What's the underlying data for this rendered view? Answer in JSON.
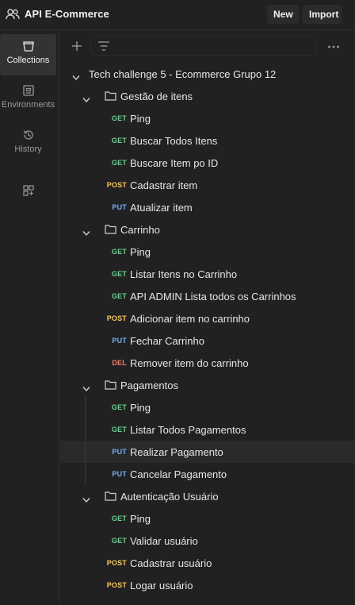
{
  "header": {
    "workspace_title": "API E-Commerce",
    "new_label": "New",
    "import_label": "Import"
  },
  "sidebar": {
    "items": [
      {
        "label": "Collections",
        "icon": "collections-icon",
        "active": true
      },
      {
        "label": "Environments",
        "icon": "environments-icon",
        "active": false
      },
      {
        "label": "History",
        "icon": "history-icon",
        "active": false
      },
      {
        "label": "",
        "icon": "add-apps-icon",
        "active": false
      }
    ]
  },
  "collection": {
    "name": "Tech challenge 5 - Ecommerce Grupo 12",
    "folders": [
      {
        "name": "Gestão de itens",
        "requests": [
          {
            "method": "GET",
            "name": "Ping"
          },
          {
            "method": "GET",
            "name": "Buscar Todos Itens"
          },
          {
            "method": "GET",
            "name": "Buscare Item po ID"
          },
          {
            "method": "POST",
            "name": "Cadastrar item"
          },
          {
            "method": "PUT",
            "name": "Atualizar item"
          }
        ]
      },
      {
        "name": "Carrinho",
        "requests": [
          {
            "method": "GET",
            "name": "Ping"
          },
          {
            "method": "GET",
            "name": "Listar Itens no Carrinho"
          },
          {
            "method": "GET",
            "name": "API ADMIN Lista todos os Carrinhos"
          },
          {
            "method": "POST",
            "name": "Adicionar item no carrinho"
          },
          {
            "method": "PUT",
            "name": "Fechar Carrinho"
          },
          {
            "method": "DEL",
            "name": "Remover item do carrinho"
          }
        ]
      },
      {
        "name": "Pagamentos",
        "requests": [
          {
            "method": "GET",
            "name": "Ping"
          },
          {
            "method": "GET",
            "name": "Listar Todos Pagamentos"
          },
          {
            "method": "PUT",
            "name": "Realizar Pagamento",
            "hovered": true
          },
          {
            "method": "PUT",
            "name": "Cancelar Pagamento"
          }
        ]
      },
      {
        "name": "Autenticação Usuário",
        "requests": [
          {
            "method": "GET",
            "name": "Ping"
          },
          {
            "method": "GET",
            "name": "Validar usuário"
          },
          {
            "method": "POST",
            "name": "Cadastrar usuário"
          },
          {
            "method": "POST",
            "name": "Logar usuário"
          }
        ]
      }
    ]
  },
  "colors": {
    "GET": "#6bcf8e",
    "POST": "#f5c85c",
    "PUT": "#74aef6",
    "DEL": "#f07a6a"
  }
}
